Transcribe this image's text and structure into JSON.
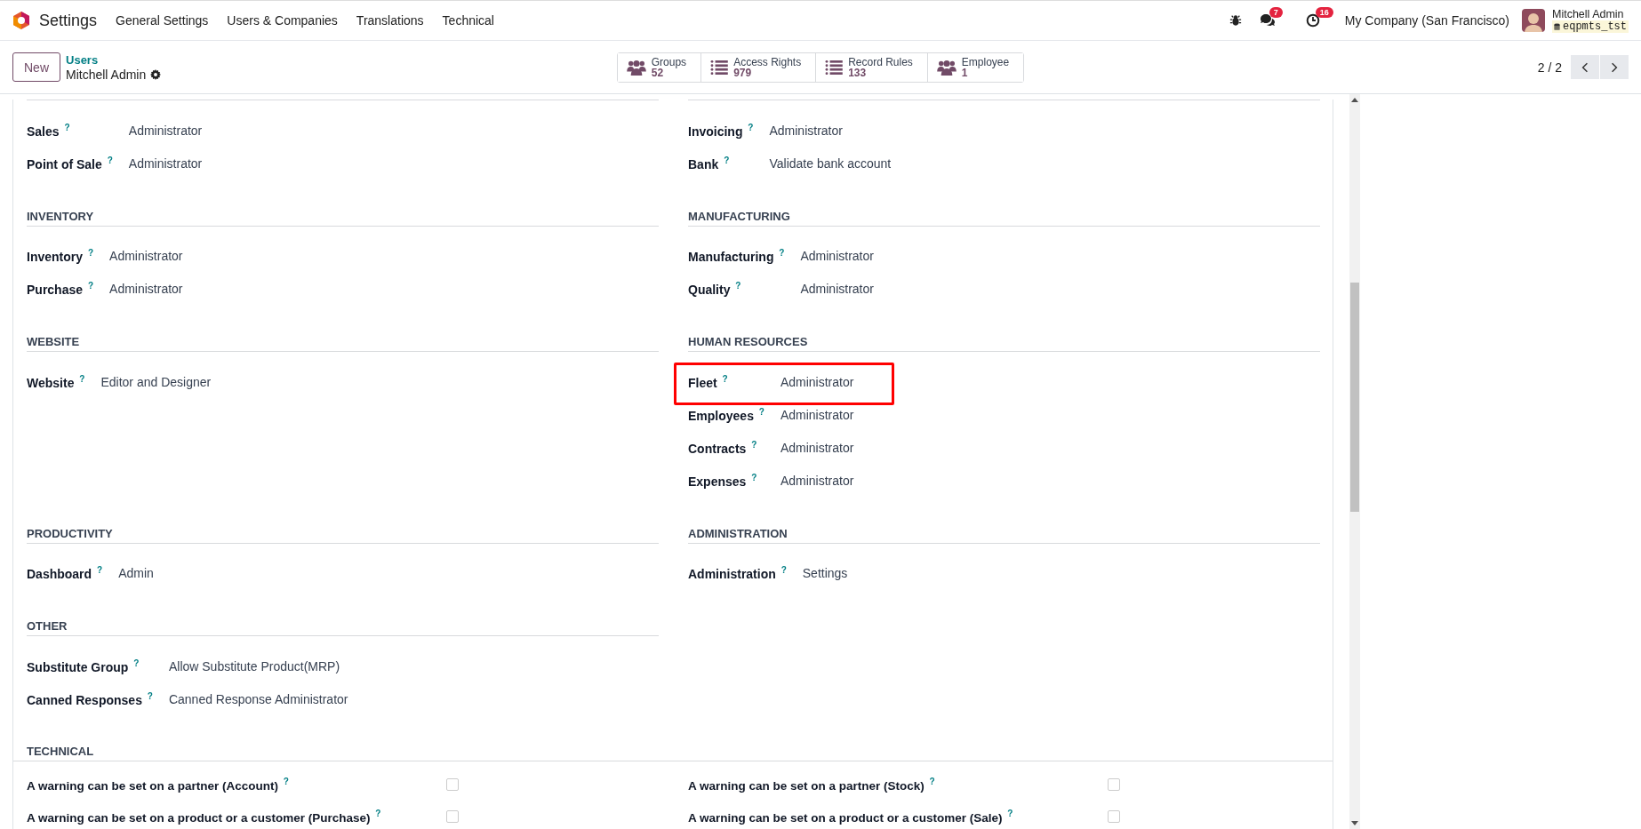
{
  "navbar": {
    "app_name": "Settings",
    "menu": [
      "General Settings",
      "Users & Companies",
      "Translations",
      "Technical"
    ],
    "chat_count": "7",
    "activity_count": "16",
    "company": "My Company (San Francisco)",
    "user_name": "Mitchell Admin",
    "database": "eqpmts_tst"
  },
  "control_panel": {
    "new_button": "New",
    "breadcrumb": "Users",
    "record_title": "Mitchell Admin",
    "pager": "2 / 2",
    "smart_buttons": [
      {
        "label": "Groups",
        "count": "52",
        "kind": "people"
      },
      {
        "label": "Access Rights",
        "count": "979",
        "kind": "list"
      },
      {
        "label": "Record Rules",
        "count": "133",
        "kind": "list"
      },
      {
        "label": "Employee",
        "count": "1",
        "kind": "people"
      }
    ]
  },
  "group_rows": [
    {
      "groups": [
        {
          "fields": [
            {
              "label": "Sales",
              "help": "?",
              "value": "Administrator",
              "highlighted": false
            },
            {
              "label": "Point of Sale",
              "help": "?",
              "value": "Administrator",
              "highlighted": false
            }
          ]
        },
        {
          "fields": [
            {
              "label": "Invoicing",
              "help": "?",
              "value": "Administrator",
              "highlighted": false
            },
            {
              "label": "Bank",
              "help": "?",
              "value": "Validate bank account",
              "highlighted": false
            }
          ]
        }
      ]
    },
    {
      "groups": [
        {
          "heading": "INVENTORY",
          "fields": [
            {
              "label": "Inventory",
              "help": "?",
              "value": "Administrator",
              "highlighted": false
            },
            {
              "label": "Purchase",
              "help": "?",
              "value": "Administrator",
              "highlighted": false
            }
          ]
        },
        {
          "heading": "MANUFACTURING",
          "fields": [
            {
              "label": "Manufacturing",
              "help": "?",
              "value": "Administrator",
              "highlighted": false
            },
            {
              "label": "Quality",
              "help": "?",
              "value": "Administrator",
              "highlighted": false
            }
          ]
        }
      ]
    },
    {
      "groups": [
        {
          "heading": "WEBSITE",
          "fields": [
            {
              "label": "Website",
              "help": "?",
              "value": "Editor and Designer",
              "highlighted": false
            }
          ]
        },
        {
          "heading": "HUMAN RESOURCES",
          "fields": [
            {
              "label": "Fleet",
              "help": "?",
              "value": "Administrator",
              "highlighted": true
            },
            {
              "label": "Employees",
              "help": "?",
              "value": "Administrator",
              "highlighted": false
            },
            {
              "label": "Contracts",
              "help": "?",
              "value": "Administrator",
              "highlighted": false
            },
            {
              "label": "Expenses",
              "help": "?",
              "value": "Administrator",
              "highlighted": false
            }
          ]
        }
      ]
    },
    {
      "groups": [
        {
          "heading": "PRODUCTIVITY",
          "fields": [
            {
              "label": "Dashboard",
              "help": "?",
              "value": "Admin",
              "highlighted": false
            }
          ]
        },
        {
          "heading": "ADMINISTRATION",
          "fields": [
            {
              "label": "Administration",
              "help": "?",
              "value": "Settings",
              "highlighted": false
            }
          ]
        }
      ]
    },
    {
      "groups": [
        {
          "heading": "OTHER",
          "fields": [
            {
              "label": "Substitute Group",
              "help": "?",
              "value": "Allow Substitute Product(MRP)",
              "highlighted": false
            },
            {
              "label": "Canned Responses",
              "help": "?",
              "value": "Canned Response Administrator",
              "highlighted": false
            }
          ]
        }
      ]
    }
  ],
  "technical": {
    "heading": "TECHNICAL",
    "options": [
      {
        "label": "A warning can be set on a partner (Account)",
        "help": "?",
        "checked": false
      },
      {
        "label": "A warning can be set on a partner (Stock)",
        "help": "?",
        "checked": false
      },
      {
        "label": "A warning can be set on a product or a customer (Purchase)",
        "help": "?",
        "checked": false
      },
      {
        "label": "A warning can be set on a product or a customer (Sale)",
        "help": "?",
        "checked": false
      }
    ]
  }
}
